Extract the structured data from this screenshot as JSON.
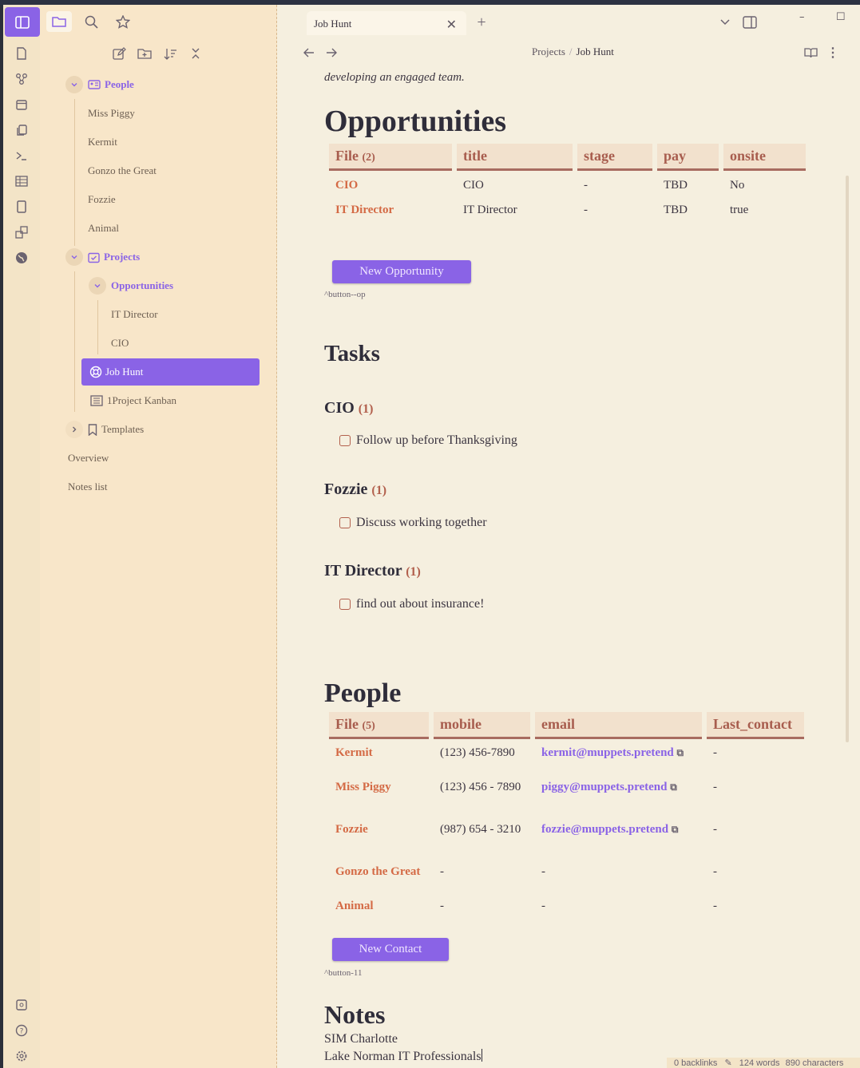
{
  "app": {
    "accent": "#8a63e6"
  },
  "tab": {
    "title": "Job Hunt"
  },
  "breadcrumb": {
    "parent": "Projects",
    "sep": "/",
    "current": "Job Hunt"
  },
  "sidebar": {
    "tree": {
      "people": "People",
      "miss_piggy": "Miss Piggy",
      "kermit": "Kermit",
      "gonzo": "Gonzo the Great",
      "fozzie": "Fozzie",
      "animal": "Animal",
      "projects": "Projects",
      "opportunities": "Opportunities",
      "it_director": "IT Director",
      "cio": "CIO",
      "job_hunt": "Job Hunt",
      "kanban": "1Project Kanban",
      "templates": "Templates",
      "overview": "Overview",
      "notes_list": "Notes list"
    }
  },
  "doc": {
    "intro": "developing an engaged team.",
    "opportunities": {
      "heading": "Opportunities",
      "headers": {
        "file": "File",
        "file_count": "(2)",
        "title": "title",
        "stage": "stage",
        "pay": "pay",
        "onsite": "onsite"
      },
      "rows": [
        {
          "file": "CIO",
          "title": "CIO",
          "stage": "-",
          "pay": "TBD",
          "onsite": "No"
        },
        {
          "file": "IT Director",
          "title": "IT Director",
          "stage": "-",
          "pay": "TBD",
          "onsite": "true"
        }
      ],
      "button": "New Opportunity",
      "blockref": "^button--op"
    },
    "tasks": {
      "heading": "Tasks",
      "groups": [
        {
          "name": "CIO",
          "count": "(1)",
          "task": "Follow up before Thanksgiving"
        },
        {
          "name": "Fozzie",
          "count": "(1)",
          "task": "Discuss working together"
        },
        {
          "name": "IT Director",
          "count": "(1)",
          "task": "find out about insurance!"
        }
      ]
    },
    "people": {
      "heading": "People",
      "headers": {
        "file": "File",
        "file_count": "(5)",
        "mobile": "mobile",
        "email": "email",
        "last_contact": "Last_contact"
      },
      "rows": [
        {
          "file": "Kermit",
          "mobile": "(123) 456-7890",
          "email": "kermit@muppets.pretend",
          "last": "-"
        },
        {
          "file": "Miss Piggy",
          "mobile": "(123) 456 - 7890",
          "email": "piggy@muppets.pretend",
          "last": "-"
        },
        {
          "file": "Fozzie",
          "mobile": "(987) 654 - 3210",
          "email": "fozzie@muppets.pretend",
          "last": "-"
        },
        {
          "file": "Gonzo the Great",
          "mobile": "-",
          "email": "-",
          "last": "-"
        },
        {
          "file": "Animal",
          "mobile": "-",
          "email": "-",
          "last": "-"
        }
      ],
      "button": "New Contact",
      "blockref": "^button-11"
    },
    "notes": {
      "heading": "Notes",
      "line1": "SIM Charlotte",
      "line2": "Lake Norman IT Professionals"
    }
  },
  "status": {
    "backlinks": "0 backlinks",
    "words": "124 words",
    "chars": "890 characters"
  }
}
